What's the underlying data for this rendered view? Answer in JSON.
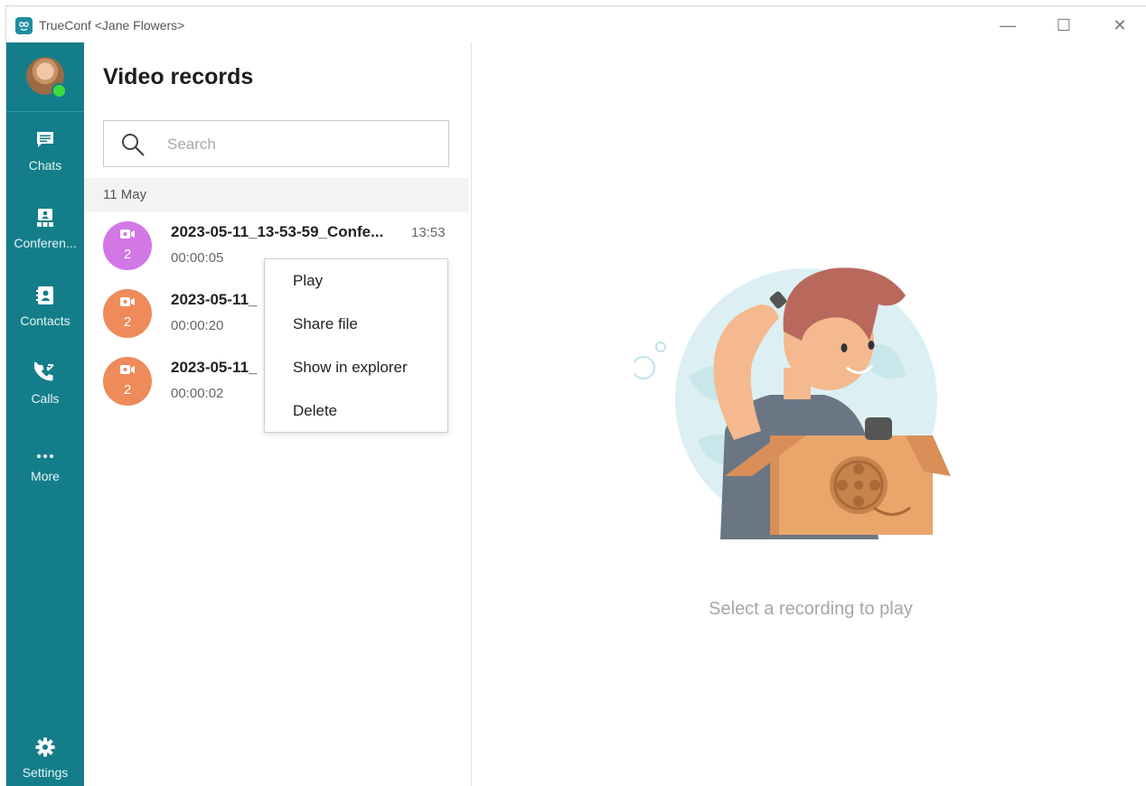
{
  "window": {
    "title": "TrueConf <Jane Flowers>",
    "controls": {
      "minimize": "—",
      "maximize": "☐",
      "close": "✕"
    }
  },
  "colors": {
    "sidebar": "#137e8a",
    "record_purple": "#d277e6",
    "record_orange": "#ef8a5b",
    "status_online": "#3ddc3d"
  },
  "sidebar": {
    "items": [
      {
        "label": "Chats",
        "icon": "chat-icon"
      },
      {
        "label": "Conferen...",
        "icon": "conference-icon"
      },
      {
        "label": "Contacts",
        "icon": "contacts-icon"
      },
      {
        "label": "Calls",
        "icon": "calls-icon"
      },
      {
        "label": "More",
        "icon": "more-icon"
      }
    ],
    "settings": {
      "label": "Settings",
      "icon": "gear-icon"
    }
  },
  "panel": {
    "title": "Video records",
    "search_placeholder": "Search",
    "group": "11 May",
    "records": [
      {
        "name": "2023-05-11_13-53-59_Confe...",
        "time": "13:53",
        "duration": "00:00:05",
        "count": "2",
        "color": "purple"
      },
      {
        "name": "2023-05-11_",
        "time": "",
        "duration": "00:00:20",
        "count": "2",
        "color": "orange"
      },
      {
        "name": "2023-05-11_",
        "time": "",
        "duration": "00:00:02",
        "count": "2",
        "color": "orange"
      }
    ]
  },
  "context_menu": {
    "items": [
      "Play",
      "Share file",
      "Show in explorer",
      "Delete"
    ]
  },
  "content": {
    "empty_text": "Select a recording to play"
  }
}
